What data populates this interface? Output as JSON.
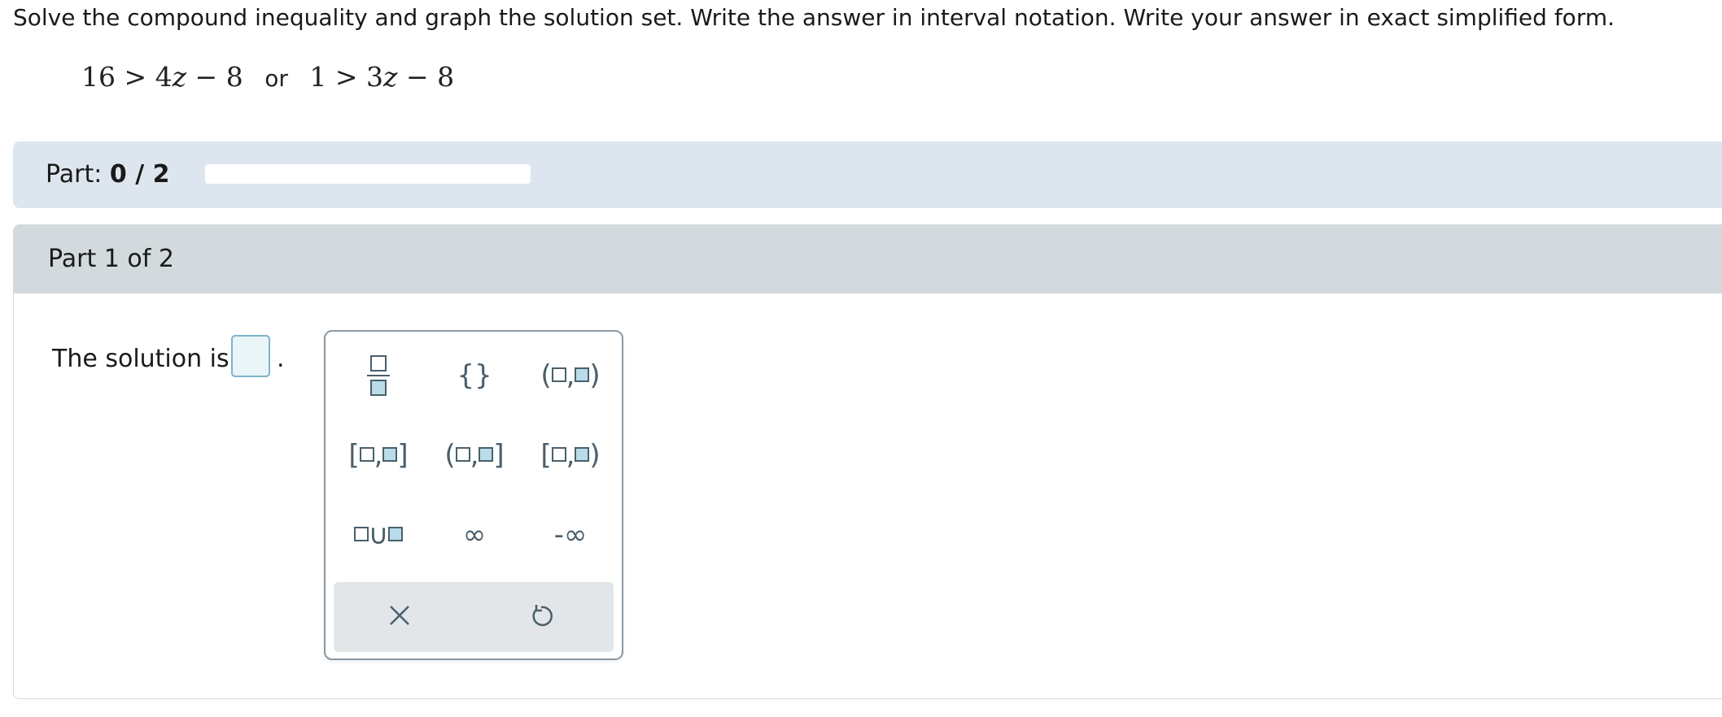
{
  "question": {
    "prompt": "Solve the compound inequality and graph the solution set. Write the answer in interval notation. Write your answer in exact simplified form.",
    "inequality_left": {
      "lhs": "16",
      "op": ">",
      "coef": "4",
      "var": "z",
      "minus": "−",
      "const": "8"
    },
    "connector": "or",
    "inequality_right": {
      "lhs": "1",
      "op": ">",
      "coef": "3",
      "var": "z",
      "minus": "−",
      "const": "8"
    }
  },
  "progress": {
    "label": "Part:",
    "value_text": "0 / 2",
    "fraction_complete": 0
  },
  "part": {
    "header": "Part 1 of 2",
    "solution_label": "The solution is",
    "period": "."
  },
  "palette": {
    "keys": [
      {
        "name": "fraction-key",
        "icon": "fraction-template-icon"
      },
      {
        "name": "set-braces-key",
        "label": "{}"
      },
      {
        "name": "open-interval-key",
        "open": "(",
        "close": ")",
        "sep": ","
      },
      {
        "name": "closed-interval-key",
        "open": "[",
        "close": "]",
        "sep": ","
      },
      {
        "name": "left-open-interval-key",
        "open": "(",
        "close": "]",
        "sep": ","
      },
      {
        "name": "right-open-interval-key",
        "open": "[",
        "close": ")",
        "sep": ","
      },
      {
        "name": "union-key",
        "label": "∪"
      },
      {
        "name": "infinity-key",
        "label": "∞"
      },
      {
        "name": "negative-infinity-key",
        "label": "-∞"
      }
    ],
    "actions": [
      {
        "name": "clear-button",
        "icon": "close-icon",
        "glyph": "✕"
      },
      {
        "name": "undo-button",
        "icon": "undo-icon"
      }
    ]
  },
  "colors": {
    "progress_bar_bg": "#dde6ee",
    "part_header_bg": "#d3dadd",
    "palette_icon": "#4a5f6b",
    "answer_box_border": "#7fb3c7"
  }
}
